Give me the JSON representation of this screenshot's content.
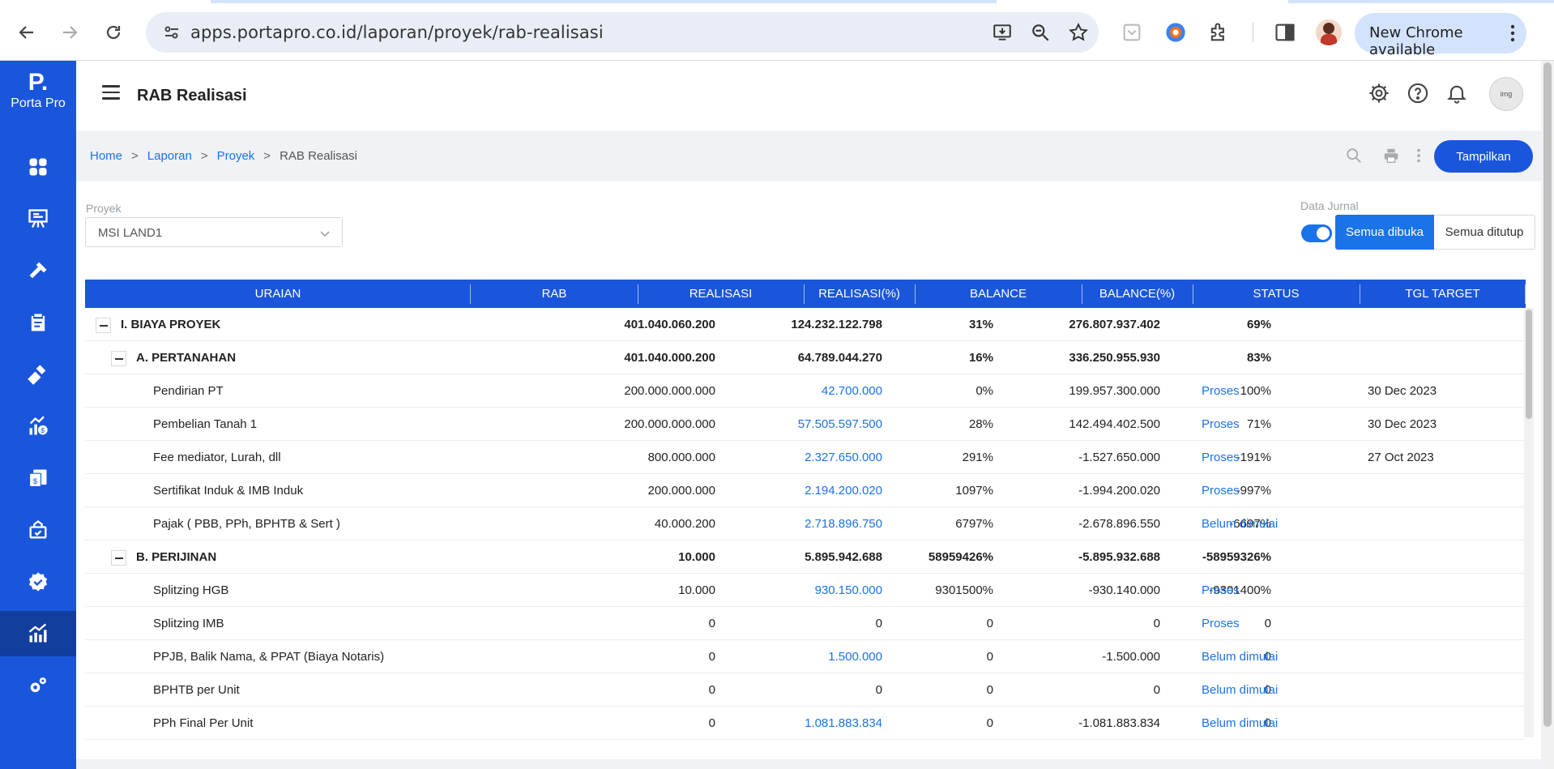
{
  "browser": {
    "url": "apps.portapro.co.id/laporan/proyek/rab-realisasi",
    "new_chrome_label": "New Chrome available"
  },
  "sidebar": {
    "logo_mark": "P.",
    "logo_text": "Porta Pro",
    "items": [
      {
        "name": "dashboard-icon"
      },
      {
        "name": "project-board-icon"
      },
      {
        "name": "hammer-icon"
      },
      {
        "name": "clipboard-icon"
      },
      {
        "name": "construction-icon"
      },
      {
        "name": "finance-chart-icon"
      },
      {
        "name": "invoice-icon"
      },
      {
        "name": "asset-icon"
      },
      {
        "name": "approval-badge-icon"
      },
      {
        "name": "report-chart-icon",
        "active": true
      },
      {
        "name": "settings-gears-icon"
      }
    ]
  },
  "header": {
    "title": "RAB Realisasi",
    "avatar_text": "img"
  },
  "breadcrumb": {
    "items": [
      "Home",
      "Laporan",
      "Proyek"
    ],
    "current": "RAB Realisasi",
    "action_label": "Tampilkan"
  },
  "filters": {
    "proyek_label": "Proyek",
    "proyek_value": "MSI LAND1",
    "jurnal_label": "Data Jurnal",
    "jurnal_enabled": true,
    "expand_all_label": "Semua dibuka",
    "collapse_all_label": "Semua ditutup"
  },
  "table": {
    "columns": [
      "URAIAN",
      "RAB",
      "REALISASI",
      "REALISASI(%)",
      "BALANCE",
      "BALANCE(%)",
      "STATUS",
      "TGL TARGET"
    ],
    "rows": [
      {
        "level": 0,
        "bold": true,
        "collapsible": true,
        "uraian": "I. BIAYA PROYEK",
        "rab": "401.040.060.200",
        "realisasi": "124.232.122.798",
        "realisasi_pct": "31%",
        "balance": "276.807.937.402",
        "balance_pct": "69%",
        "status": "",
        "tgl": ""
      },
      {
        "level": 1,
        "bold": true,
        "collapsible": true,
        "uraian": "A. PERTANAHAN",
        "rab": "401.040.000.200",
        "realisasi": "64.789.044.270",
        "realisasi_pct": "16%",
        "balance": "336.250.955.930",
        "balance_pct": "83%",
        "status": "",
        "tgl": ""
      },
      {
        "level": 2,
        "bold": false,
        "link": true,
        "uraian": "Pendirian PT",
        "rab": "200.000.000.000",
        "realisasi": "42.700.000",
        "realisasi_pct": "0%",
        "balance": "199.957.300.000",
        "balance_pct": "100%",
        "status": "Proses",
        "tgl": "30 Dec 2023"
      },
      {
        "level": 2,
        "bold": false,
        "link": true,
        "uraian": "Pembelian Tanah 1",
        "rab": "200.000.000.000",
        "realisasi": "57.505.597.500",
        "realisasi_pct": "28%",
        "balance": "142.494.402.500",
        "balance_pct": "71%",
        "status": "Proses",
        "tgl": "30 Dec 2023"
      },
      {
        "level": 2,
        "bold": false,
        "link": true,
        "uraian": "Fee mediator, Lurah, dll",
        "rab": "800.000.000",
        "realisasi": "2.327.650.000",
        "realisasi_pct": "291%",
        "balance": "-1.527.650.000",
        "balance_pct": "-191%",
        "status": "Proses",
        "tgl": "27 Oct 2023"
      },
      {
        "level": 2,
        "bold": false,
        "link": true,
        "uraian": "Sertifikat Induk & IMB Induk",
        "rab": "200.000.000",
        "realisasi": "2.194.200.020",
        "realisasi_pct": "1097%",
        "balance": "-1.994.200.020",
        "balance_pct": "-997%",
        "status": "Proses",
        "tgl": ""
      },
      {
        "level": 2,
        "bold": false,
        "link": true,
        "uraian": "Pajak ( PBB, PPh, BPHTB & Sert )",
        "rab": "40.000.200",
        "realisasi": "2.718.896.750",
        "realisasi_pct": "6797%",
        "balance": "-2.678.896.550",
        "balance_pct": "-6697%",
        "status": "Belum dimulai",
        "tgl": ""
      },
      {
        "level": 1,
        "bold": true,
        "collapsible": true,
        "uraian": "B. PERIJINAN",
        "rab": "10.000",
        "realisasi": "5.895.942.688",
        "realisasi_pct": "58959426%",
        "balance": "-5.895.932.688",
        "balance_pct": "-58959326%",
        "status": "",
        "tgl": ""
      },
      {
        "level": 2,
        "bold": false,
        "link": true,
        "uraian": "Splitzing HGB",
        "rab": "10.000",
        "realisasi": "930.150.000",
        "realisasi_pct": "9301500%",
        "balance": "-930.140.000",
        "balance_pct": "-9301400%",
        "status": "Proses",
        "tgl": ""
      },
      {
        "level": 2,
        "bold": false,
        "link": false,
        "uraian": "Splitzing IMB",
        "rab": "0",
        "realisasi": "0",
        "realisasi_pct": "0",
        "balance": "0",
        "balance_pct": "0",
        "status": "Proses",
        "tgl": ""
      },
      {
        "level": 2,
        "bold": false,
        "link": true,
        "uraian": "PPJB, Balik Nama, & PPAT (Biaya Notaris)",
        "rab": "0",
        "realisasi": "1.500.000",
        "realisasi_pct": "0",
        "balance": "-1.500.000",
        "balance_pct": "0",
        "status": "Belum dimulai",
        "tgl": ""
      },
      {
        "level": 2,
        "bold": false,
        "link": false,
        "uraian": "BPHTB per Unit",
        "rab": "0",
        "realisasi": "0",
        "realisasi_pct": "0",
        "balance": "0",
        "balance_pct": "0",
        "status": "Belum dimulai",
        "tgl": ""
      },
      {
        "level": 2,
        "bold": false,
        "link": true,
        "uraian": "PPh Final Per Unit",
        "rab": "0",
        "realisasi": "1.081.883.834",
        "realisasi_pct": "0",
        "balance": "-1.081.883.834",
        "balance_pct": "0",
        "status": "Belum dimulai",
        "tgl": ""
      }
    ]
  },
  "colors": {
    "brand_blue": "#1a56db",
    "link_blue": "#1a73e8",
    "active_nav": "#123f9e"
  }
}
